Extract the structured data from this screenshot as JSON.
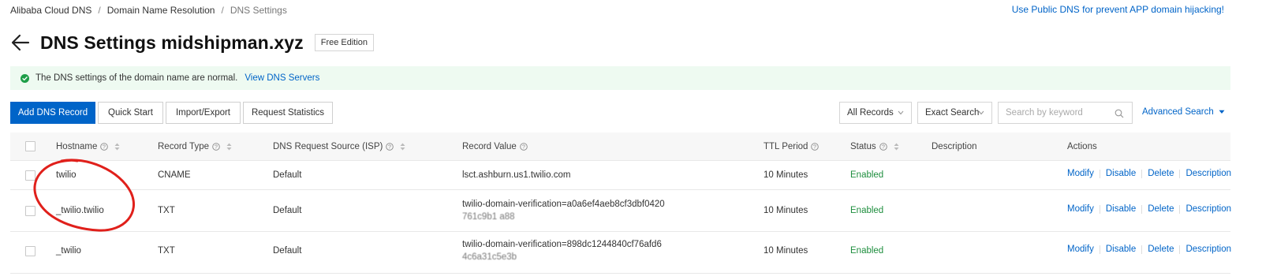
{
  "breadcrumb": {
    "items": [
      "Alibaba Cloud DNS",
      "Domain Name Resolution",
      "DNS Settings"
    ],
    "separator": "/"
  },
  "top_link": "Use Public DNS for prevent APP domain hijacking!",
  "page": {
    "title": "DNS Settings midshipman.xyz",
    "edition": "Free Edition"
  },
  "notice": {
    "text": "The DNS settings of the domain name are normal.",
    "link": "View DNS Servers"
  },
  "toolbar": {
    "add_record": "Add DNS Record",
    "quick_start": "Quick Start",
    "import_export": "Import/Export",
    "request_statistics": "Request Statistics",
    "records_filter": "All Records",
    "search_mode": "Exact Search",
    "search_placeholder": "Search by keyword",
    "advanced_search": "Advanced Search"
  },
  "table": {
    "headers": {
      "hostname": "Hostname",
      "record_type": "Record Type",
      "isp": "DNS Request Source (ISP)",
      "record_value": "Record Value",
      "ttl": "TTL Period",
      "status": "Status",
      "description": "Description",
      "actions": "Actions"
    },
    "rows": [
      {
        "hostname": "twilio",
        "type": "CNAME",
        "isp": "Default",
        "value_line1": "lsct.ashburn.us1.twilio.com",
        "value_line2": "",
        "ttl": "10 Minutes",
        "status": "Enabled"
      },
      {
        "hostname": "_twilio.twilio",
        "type": "TXT",
        "isp": "Default",
        "value_line1": "twilio-domain-verification=a0a6ef4aeb8cf3dbf0420",
        "value_line2": "761c9b1 a88",
        "ttl": "10 Minutes",
        "status": "Enabled"
      },
      {
        "hostname": "_twilio",
        "type": "TXT",
        "isp": "Default",
        "value_line1": "twilio-domain-verification=898dc1244840cf76afd6",
        "value_line2": "4c6a31c5e3b",
        "ttl": "10 Minutes",
        "status": "Enabled"
      }
    ],
    "actions": [
      "Modify",
      "Disable",
      "Delete",
      "Description"
    ]
  },
  "colors": {
    "accent": "#0064c8",
    "status_enabled": "#1e8e3e",
    "notice_bg": "#eefaf1",
    "annotation": "#e0201b"
  },
  "icons": [
    "back-arrow-icon",
    "check-circle-icon",
    "help-icon",
    "sort-icon",
    "chevron-down-icon",
    "search-icon"
  ]
}
